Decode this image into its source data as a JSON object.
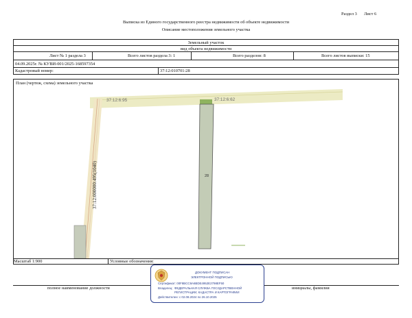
{
  "header": {
    "section": "Раздел 3",
    "sheet": "Лист 6",
    "title": "Выписка из Единого государственного реестра недвижимости об объекте недвижимости",
    "subtitle": "Описание местоположения земельного участка"
  },
  "object": {
    "name": "Земельный участок",
    "kind_caption": "вид объекта недвижимости"
  },
  "sheet_row": {
    "sheet_in_section": "Лист № 1 раздела 3",
    "total_sheets_section": "Всего листов раздела 3: 1",
    "total_sections": "Всего разделов: 8",
    "total_sheets_extract": "Всего листов выписки: 15"
  },
  "extract_number": "04.09.2025г. № КУВИ-001/2025-168597354",
  "cadastral": {
    "label": "Кадастровый номер:",
    "value": "37:12:010701:28"
  },
  "plan": {
    "title": "План (чертеж, схема) земельного участка",
    "label_top_left": "37:12:6:95",
    "label_top_right": "37:12:6:62",
    "label_vertical": "37:12:000000:495(1040)",
    "label_parcel": "28",
    "colors": {
      "road": "#ecebc4",
      "road_line": "#cfcf8f",
      "parcel": "#c3ccb6",
      "parcel_stroke": "#555555",
      "green_strip": "#8fb35f",
      "vertical_road": "#f1e7c6"
    }
  },
  "footer": {
    "scale": "Масштаб 1:900",
    "legend_label": "Условные обозначения:",
    "position_caption": "полное наименование должности",
    "name_caption": "инициалы, фамилия"
  },
  "signature": {
    "line1": "ДОКУМЕНТ ПОДПИСАН",
    "line2": "ЭЛЕКТРОННОЙ ПОДПИСЬЮ",
    "cert": "Сертификат: 00F8BCC8A6BDE4952E2798EF50",
    "owner_label": "Владелец:",
    "owner1": "ФЕДЕРАЛЬНАЯ СЛУЖБА ГОСУДАРСТВЕННОЙ",
    "owner2": "РЕГИСТРАЦИИ, КАДАСТРА И КАРТОГРАФИИ",
    "valid": "Действителен: с 02.08.2024 по 26.10.2025"
  }
}
